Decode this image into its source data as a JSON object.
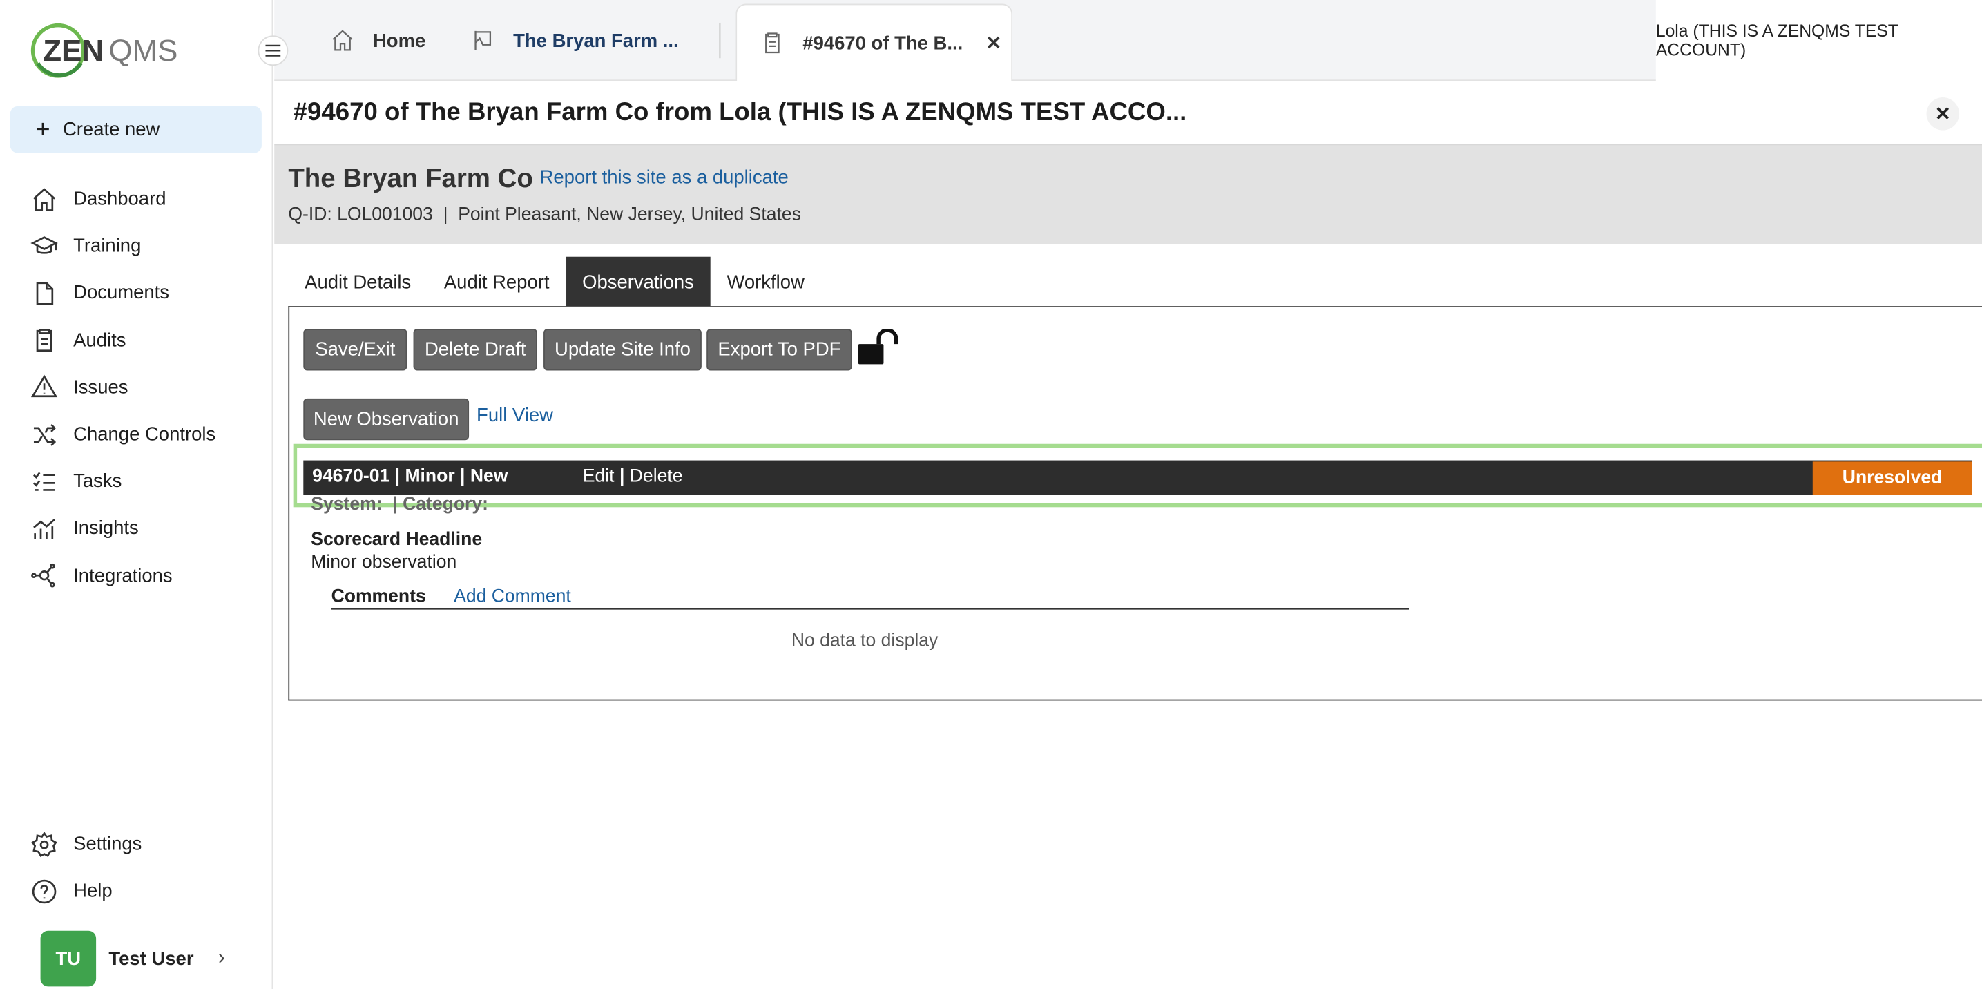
{
  "app": {
    "logo_text_zen": "ZEN",
    "logo_text_qms": "QMS",
    "create_new": "Create new"
  },
  "sidebar": {
    "items": [
      {
        "label": "Dashboard",
        "icon": "home-icon"
      },
      {
        "label": "Training",
        "icon": "graduation-cap-icon"
      },
      {
        "label": "Documents",
        "icon": "document-icon"
      },
      {
        "label": "Audits",
        "icon": "clipboard-icon"
      },
      {
        "label": "Issues",
        "icon": "warning-icon"
      },
      {
        "label": "Change Controls",
        "icon": "shuffle-icon"
      },
      {
        "label": "Tasks",
        "icon": "checklist-icon"
      },
      {
        "label": "Insights",
        "icon": "chart-icon"
      },
      {
        "label": "Integrations",
        "icon": "network-icon"
      }
    ],
    "bottom_items": [
      {
        "label": "Settings",
        "icon": "gear-icon"
      },
      {
        "label": "Help",
        "icon": "help-icon"
      }
    ],
    "user": {
      "initials": "TU",
      "name": "Test User"
    }
  },
  "tabs": [
    {
      "label": "Home",
      "icon": "home-icon"
    },
    {
      "label": "The Bryan Farm ...",
      "icon": "flag-icon"
    },
    {
      "label": "#94670 of The B...",
      "icon": "clipboard-icon",
      "active": true
    }
  ],
  "account_label": "Lola (THIS IS A ZENQMS TEST ACCOUNT)",
  "page": {
    "title": "#94670 of The Bryan Farm Co from Lola (THIS IS A ZENQMS TEST ACCO..."
  },
  "site": {
    "name": "The Bryan Farm Co",
    "duplicate_link": "Report this site as a duplicate",
    "meta": "Q-ID: LOL001003  |  Point Pleasant, New Jersey, United States"
  },
  "inner_tabs": [
    {
      "label": "Audit Details"
    },
    {
      "label": "Audit Report"
    },
    {
      "label": "Observations",
      "active": true
    },
    {
      "label": "Workflow"
    }
  ],
  "toolbar": {
    "save_exit": "Save/Exit",
    "delete_draft": "Delete Draft",
    "update_site_info": "Update Site Info",
    "export_pdf": "Export To PDF",
    "new_observation": "New Observation",
    "full_view": "Full View"
  },
  "observation": {
    "code": "94670-01 | Minor | New",
    "edit": "Edit",
    "separator": "|",
    "delete": "Delete",
    "status": "Unresolved",
    "status_color": "#e0700f",
    "system_category": "System:  | Category:",
    "headline_label": "Scorecard Headline",
    "headline_value": "Minor observation",
    "comments_label": "Comments",
    "add_comment": "Add Comment",
    "no_data": "No data to display"
  }
}
